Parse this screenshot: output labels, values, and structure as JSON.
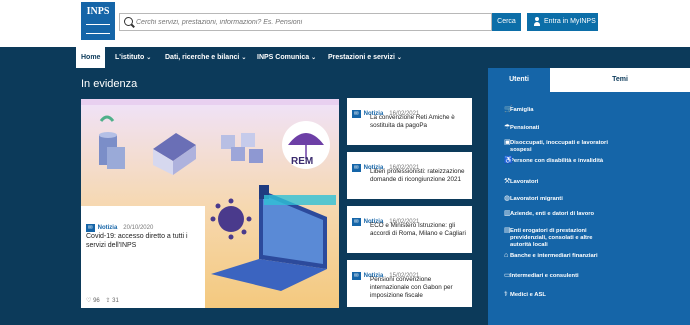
{
  "header": {
    "logo_text": "INPS",
    "search_placeholder": "Cerchi servizi, prestazioni, informazioni? Es. Pensioni",
    "search_button": "Cerca",
    "login_button": "Entra in MyINPS"
  },
  "nav": {
    "items": [
      {
        "label": "Home"
      },
      {
        "label": "L'istituto"
      },
      {
        "label": "Dati, ricerche e bilanci"
      },
      {
        "label": "INPS Comunica"
      },
      {
        "label": "Prestazioni e servizi"
      }
    ],
    "caret": "⌄"
  },
  "main": {
    "section_title": "In evidenza",
    "illustration_text": "REM",
    "featured": {
      "tag": "Notizia",
      "date": "20/10/2020",
      "title": "Covid-19: accesso diretto a tutti i servizi dell'INPS",
      "likes": "96",
      "shares": "31"
    },
    "news": [
      {
        "tag": "Notizia",
        "date": "16/02/2021",
        "title": "La convenzione Reti Amiche è sostituita da pagoPa"
      },
      {
        "tag": "Notizia",
        "date": "16/02/2021",
        "title": "Liberi professionisti: rateizzazione domande di ricongiunzione 2021"
      },
      {
        "tag": "Notizia",
        "date": "16/02/2021",
        "title": "ECO e Ministero Istruzione: gli accordi di Roma, Milano e Cagliari"
      },
      {
        "tag": "Notizia",
        "date": "15/02/2021",
        "title": "Pensioni convenzione internazionale con Gabon per imposizione fiscale"
      }
    ]
  },
  "sidebar": {
    "tabs": [
      {
        "label": "Utenti"
      },
      {
        "label": "Temi"
      }
    ],
    "items": [
      {
        "label": "Famiglia",
        "icon": "stroller-icon"
      },
      {
        "label": "Pensionati",
        "icon": "umbrella-icon"
      },
      {
        "label": "Disoccupati, inoccupati e lavoratori sospesi",
        "icon": "briefcase-icon"
      },
      {
        "label": "Persone con disabilità e invalidità",
        "icon": "wheelchair-icon"
      },
      {
        "label": "Lavoratori",
        "icon": "wrench-icon"
      },
      {
        "label": "Lavoratori migranti",
        "icon": "globe-icon"
      },
      {
        "label": "Aziende, enti e datori di lavoro",
        "icon": "building-icon"
      },
      {
        "label": "Enti erogatori di prestazioni previdenziali, consolati e altre autorità locali",
        "icon": "document-icon"
      },
      {
        "label": "Banche e intermediari finanziari",
        "icon": "bank-icon"
      },
      {
        "label": "Intermediari e consulenti",
        "icon": "case-icon"
      },
      {
        "label": "Medici e ASL",
        "icon": "stethoscope-icon"
      }
    ]
  }
}
